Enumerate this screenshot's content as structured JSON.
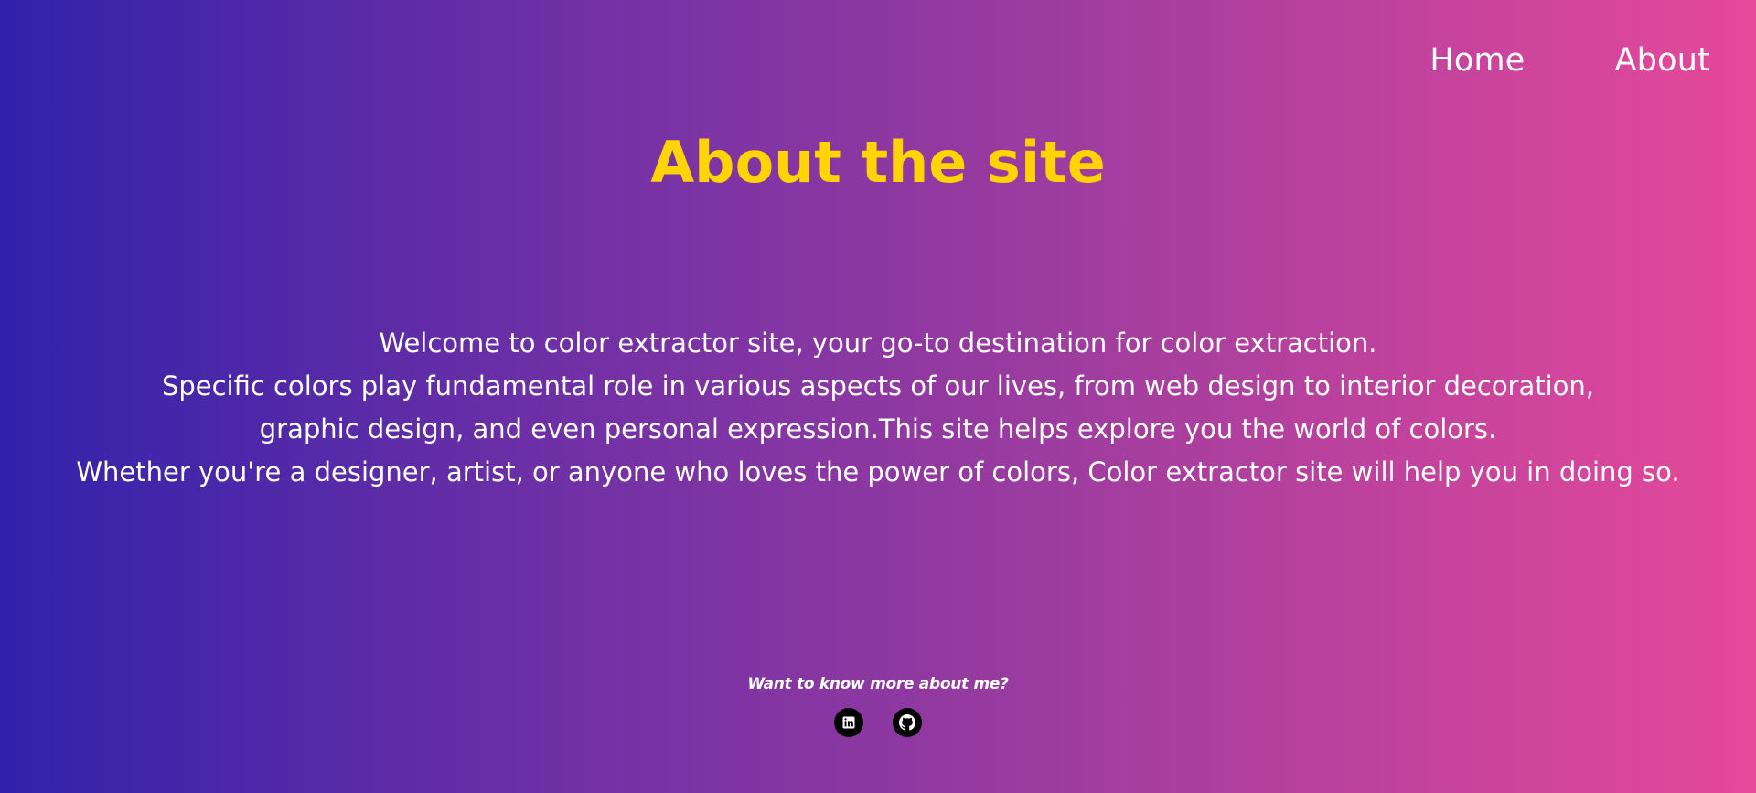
{
  "nav": {
    "items": [
      {
        "label": "Home"
      },
      {
        "label": "About"
      }
    ]
  },
  "page": {
    "title": "About the site"
  },
  "intro": {
    "lines": [
      "Welcome to color extractor site, your go-to destination for color extraction.",
      "Specific colors play fundamental role in various aspects of our lives, from web design to interior decoration,",
      "graphic design, and even personal expression.This site helps explore you the world of colors.",
      "Whether you're a designer, artist, or anyone who loves the power of colors, Color extractor site will help you in doing so."
    ]
  },
  "footer": {
    "text": "Want to know more about me?",
    "socials": [
      {
        "icon": "linkedin-icon"
      },
      {
        "icon": "github-icon"
      }
    ]
  },
  "colors": {
    "gradient_start": "#3122ab",
    "gradient_end": "#e6499a",
    "title": "#ffd400",
    "text": "#ffffff",
    "icon_bg": "#000000"
  }
}
